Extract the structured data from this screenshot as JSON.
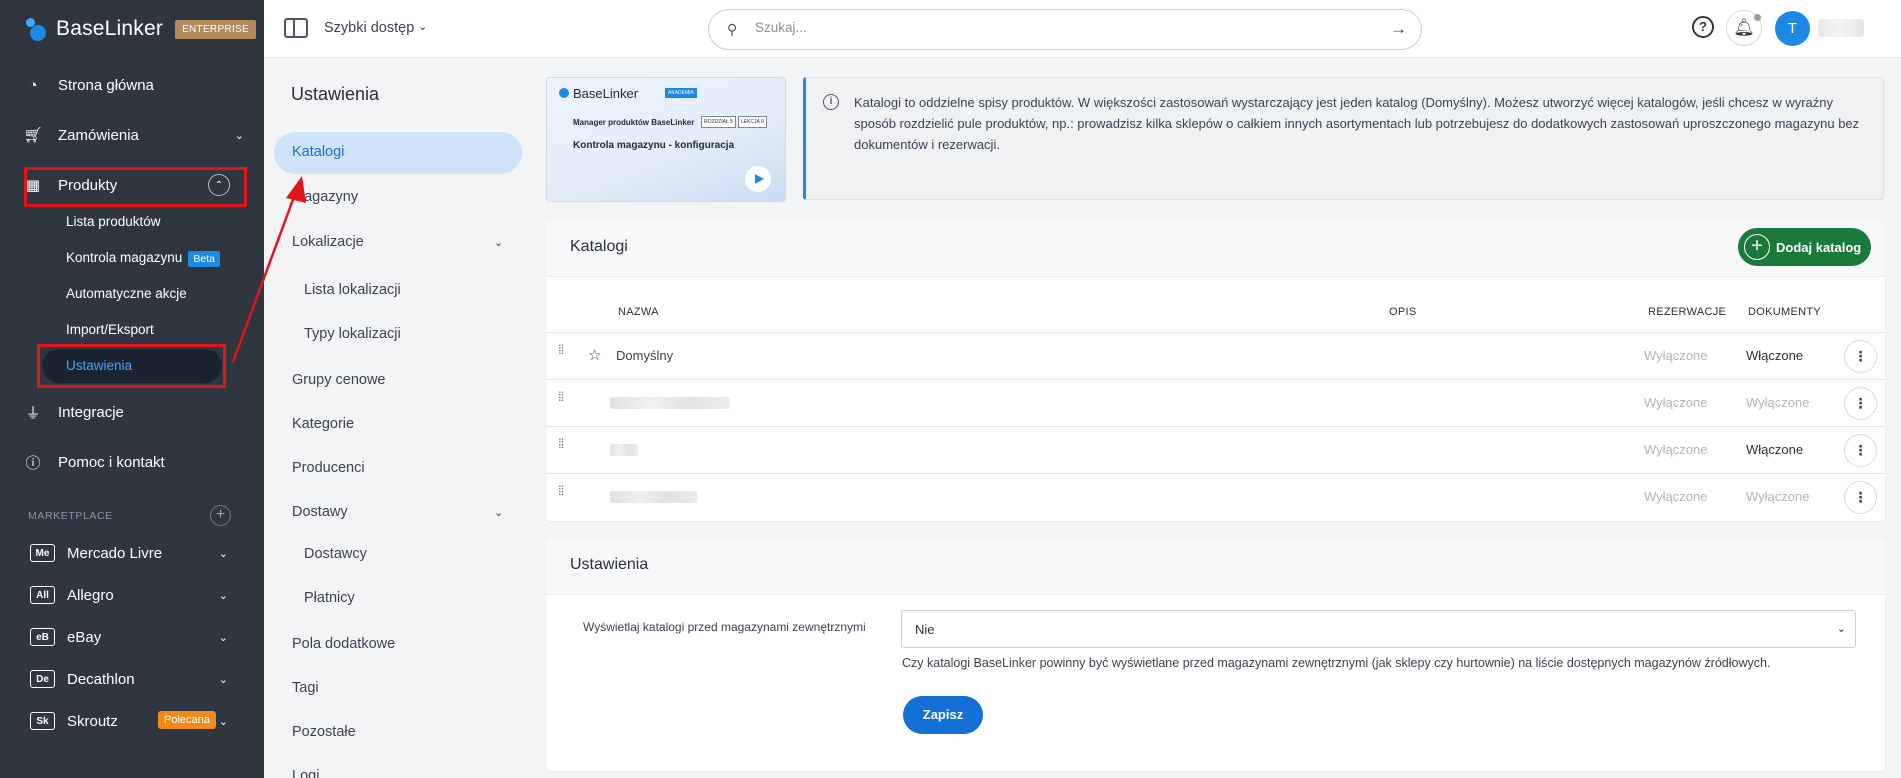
{
  "brand": {
    "name": "BaseLinker",
    "edition": "ENTERPRISE"
  },
  "sidebar": {
    "items": [
      {
        "label": "Strona główna",
        "icon": "dashboard-icon"
      },
      {
        "label": "Zamówienia",
        "icon": "cart-icon"
      },
      {
        "label": "Produkty",
        "icon": "products-icon"
      },
      {
        "label": "Integracje",
        "icon": "plug-icon"
      },
      {
        "label": "Pomoc i kontakt",
        "icon": "help-circle-icon"
      }
    ],
    "products_sub": [
      {
        "label": "Lista produktów"
      },
      {
        "label": "Kontrola magazynu",
        "badge": "Beta"
      },
      {
        "label": "Automatyczne akcje"
      },
      {
        "label": "Import/Eksport"
      },
      {
        "label": "Ustawienia"
      }
    ],
    "marketplace_label": "MARKETPLACE",
    "marketplaces": [
      {
        "abbr": "Me",
        "label": "Mercado Livre"
      },
      {
        "abbr": "All",
        "label": "Allegro"
      },
      {
        "abbr": "eB",
        "label": "eBay"
      },
      {
        "abbr": "De",
        "label": "Decathlon"
      },
      {
        "abbr": "Sk",
        "label": "Skroutz",
        "badge": "Polecana"
      }
    ]
  },
  "topbar": {
    "quick_access": "Szybki dostęp",
    "search_placeholder": "Szukaj...",
    "avatar_letter": "T"
  },
  "settings_nav": {
    "title": "Ustawienia",
    "items": [
      {
        "label": "Katalogi",
        "active": true
      },
      {
        "label": "Magazyny"
      },
      {
        "label": "Lokalizacje"
      },
      {
        "label": "Lista lokalizacji"
      },
      {
        "label": "Typy lokalizacji"
      },
      {
        "label": "Grupy cenowe"
      },
      {
        "label": "Kategorie"
      },
      {
        "label": "Producenci"
      },
      {
        "label": "Dostawy"
      },
      {
        "label": "Dostawcy"
      },
      {
        "label": "Płatnicy"
      },
      {
        "label": "Pola dodatkowe"
      },
      {
        "label": "Tagi"
      },
      {
        "label": "Pozostałe"
      },
      {
        "label": "Logi"
      }
    ]
  },
  "video": {
    "logo": "BaseLinker",
    "akademia": "AKADEMIA",
    "subtitle": "Manager produktów BaseLinker",
    "tag1": "ROZDZIAŁ 5",
    "tag2": "LEKCJA 9",
    "title": "Kontrola magazynu - konfiguracja"
  },
  "info": {
    "text": "Katalogi to oddzielne spisy produktów. W większości zastosowań wystarczający jest jeden katalog (Domyślny). Możesz utworzyć więcej katalogów, jeśli chcesz w wyraźny sposób rozdzielić pule produktów, np.: prowadzisz kilka sklepów o całkiem innych asortymentach lub potrzebujesz do dodatkowych zastosowań uproszczonego magazynu bez dokumentów i rezerwacji."
  },
  "catalogs": {
    "title": "Katalogi",
    "add_button": "Dodaj katalog",
    "columns": {
      "name": "NAZWA",
      "desc": "OPIS",
      "rez": "REZERWACJE",
      "dok": "DOKUMENTY"
    },
    "rows": [
      {
        "name": "Domyślny",
        "rez": "Wyłączone",
        "dok": "Włączone"
      },
      {
        "name": "",
        "rez": "Wyłączone",
        "dok": "Wyłączone"
      },
      {
        "name": "",
        "rez": "Wyłączone",
        "dok": "Włączone"
      },
      {
        "name": "",
        "rez": "Wyłączone",
        "dok": "Wyłączone"
      }
    ]
  },
  "settings_card": {
    "title": "Ustawienia",
    "label": "Wyświetlaj katalogi przed magazynami zewnętrznymi",
    "value": "Nie",
    "hint": "Czy katalogi BaseLinker powinny być wyświetlane przed magazynami zewnętrznymi (jak sklepy czy hurtownie) na liście dostępnych magazynów źródłowych.",
    "save": "Zapisz"
  },
  "colors": {
    "sidebar": "#2f3640",
    "accent": "#1e88e5",
    "add_green": "#1b7a3b",
    "highlight_red": "#e4141b"
  }
}
